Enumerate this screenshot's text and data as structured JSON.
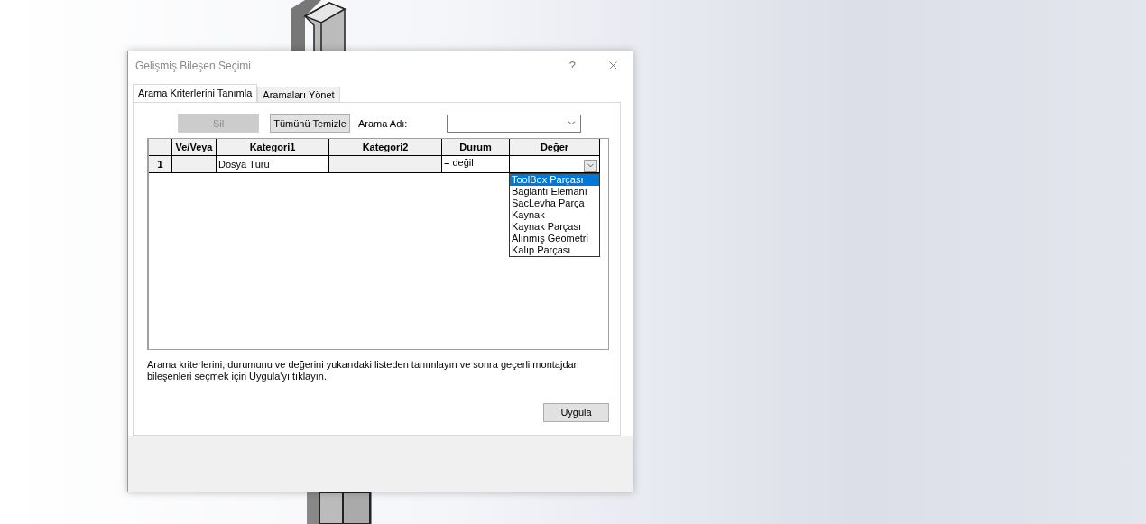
{
  "window": {
    "title": "Gelişmiş Bileşen Seçimi",
    "help": "?"
  },
  "tabs": [
    {
      "label": "Arama Kriterlerini Tanımla",
      "selected": true
    },
    {
      "label": "Aramaları Yönet",
      "selected": false
    }
  ],
  "toolbar": {
    "delete_button": {
      "label": "Sil",
      "disabled": true
    },
    "clear_button": {
      "label": "Tümünü Temizle",
      "disabled": false
    },
    "search_name_label": "Arama Adı:"
  },
  "table": {
    "columns": [
      "Ve/Veya",
      "Kategori1",
      "Kategori2",
      "Durum",
      "Değer"
    ],
    "rows": [
      {
        "number": "1",
        "kategori1": "Dosya Türü",
        "durum": "= değil"
      }
    ]
  },
  "value_dropdown": {
    "expanded": true,
    "options": [
      {
        "label": "ToolBox Parçası",
        "selected": true
      },
      {
        "label": "Bağlantı Elemanı",
        "selected": false
      },
      {
        "label": "SacLevha Parça",
        "selected": false
      },
      {
        "label": "Kaynak",
        "selected": false
      },
      {
        "label": "Kaynak Parçası",
        "selected": false
      },
      {
        "label": "Alınmış Geometri",
        "selected": false
      },
      {
        "label": "Kalıp Parçası",
        "selected": false
      }
    ]
  },
  "instructions": "Arama kriterlerini, durumunu ve değerini yukarıdaki listeden tanımlayın ve sonra geçerli montajdan bileşenleri seçmek için Uygula'yı tıklayın.",
  "apply_button": "Uygula"
}
